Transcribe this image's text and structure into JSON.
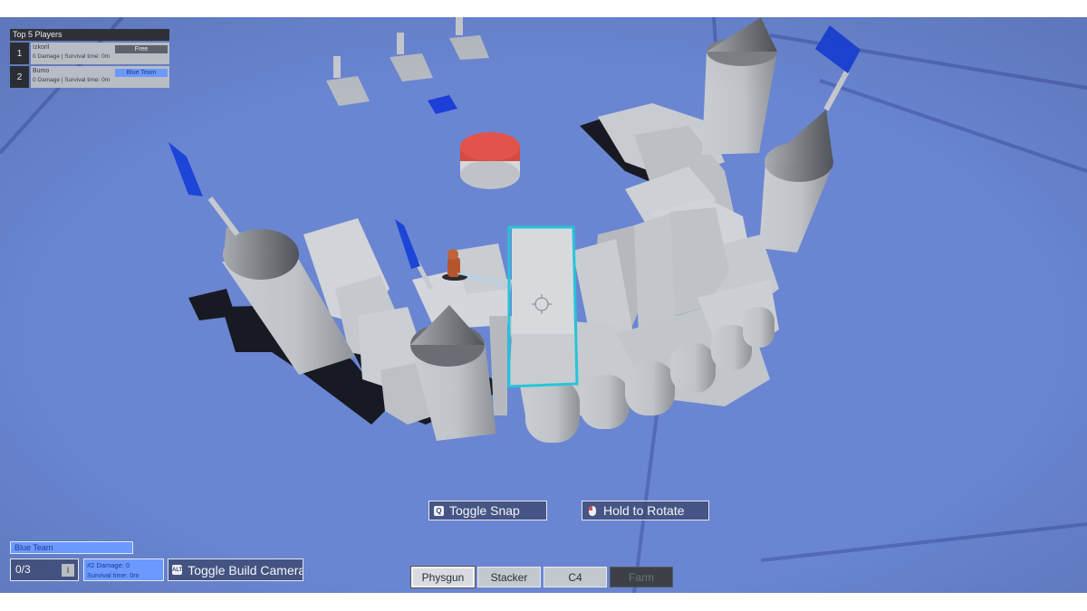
{
  "leaderboard": {
    "title": "Top 5 Players",
    "players": [
      {
        "rank": "1",
        "name": "Izkoril",
        "stats": "0 Damage | Survival time: 0m",
        "team": "Free"
      },
      {
        "rank": "2",
        "name": "Bumo",
        "stats": "0 Damage | Survival time: 0m",
        "team": "Blue Team"
      }
    ]
  },
  "prompts": {
    "snap": {
      "key": "Q",
      "label": "Toggle Snap"
    },
    "rotate": {
      "label": "Hold to Rotate"
    }
  },
  "status": {
    "team": "Blue Team",
    "counter": "0/3",
    "counter_key": "I",
    "rank_damage": "#2  Damage: 0",
    "survival": "Survival time: 0m",
    "build_camera_key": "ALT",
    "build_camera": "Toggle Build Camera"
  },
  "toolbar": {
    "tools": [
      {
        "label": "Physgun",
        "state": "active"
      },
      {
        "label": "Stacker",
        "state": "normal"
      },
      {
        "label": "C4",
        "state": "normal"
      },
      {
        "label": "Farm",
        "state": "disabled"
      }
    ]
  },
  "colors": {
    "ground": "#6a86d2",
    "blue_team": "#6b99ff",
    "selection": "#26c4d8",
    "button_red": "#e2534b",
    "flag_blue": "#1d45d8"
  },
  "icons": {
    "snap": "key-q-icon",
    "rotate": "mouse-icon",
    "build_camera": "key-alt-icon",
    "crosshair": "crosshair-icon"
  }
}
